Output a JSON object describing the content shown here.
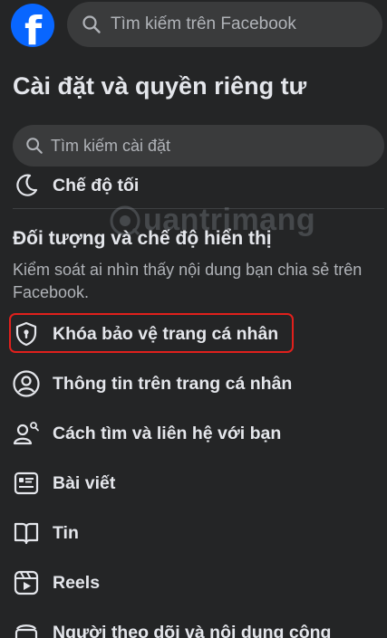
{
  "header": {
    "logo_letter": "f",
    "search_placeholder": "Tìm kiếm trên Facebook"
  },
  "page": {
    "title": "Cài đặt và quyền riêng tư",
    "search_placeholder": "Tìm kiếm cài đặt"
  },
  "prev_item": {
    "label": "Chế độ tối",
    "icon": "moon-icon"
  },
  "section": {
    "title": "Đối tượng và chế độ hiển thị",
    "description": "Kiểm soát ai nhìn thấy nội dung bạn chia sẻ trên Facebook."
  },
  "items": [
    {
      "label": "Khóa bảo vệ trang cá nhân",
      "icon": "shield-lock-icon",
      "highlighted": true
    },
    {
      "label": "Thông tin trên trang cá nhân",
      "icon": "profile-icon"
    },
    {
      "label": "Cách tìm và liên hệ với bạn",
      "icon": "people-search-icon"
    },
    {
      "label": "Bài viết",
      "icon": "post-icon"
    },
    {
      "label": "Tin",
      "icon": "book-icon"
    },
    {
      "label": "Reels",
      "icon": "reels-icon"
    },
    {
      "label": "Người theo dõi và nội dung công",
      "icon": "followers-icon"
    }
  ],
  "watermark": {
    "text": "uantrimang"
  },
  "colors": {
    "background": "#242526",
    "input_bg": "#3a3b3c",
    "text_primary": "#e4e6eb",
    "text_secondary": "#b0b3b8",
    "brand": "#0866ff",
    "highlight_border": "#e0201c"
  }
}
